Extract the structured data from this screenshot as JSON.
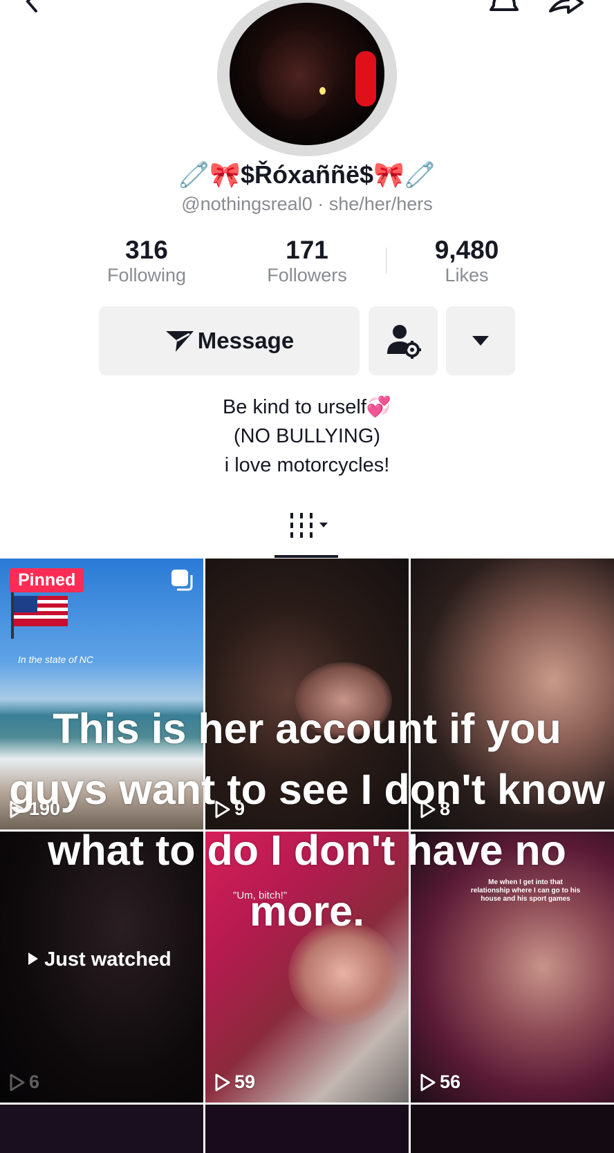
{
  "profile": {
    "display_name": "🧷🎀$Řóxaññë$🎀🧷",
    "handle_line": "@nothingsreal0 · she/her/hers",
    "stats": [
      {
        "value": "316",
        "label": "Following"
      },
      {
        "value": "171",
        "label": "Followers"
      },
      {
        "value": "9,480",
        "label": "Likes"
      }
    ],
    "bio": [
      "Be kind to urself💞",
      "(NO BULLYING)",
      "i love motorcycles!"
    ]
  },
  "actions": {
    "message_label": "Message"
  },
  "videos": [
    {
      "views": "190",
      "badge": "Pinned",
      "caption": "In the state of NC"
    },
    {
      "views": "9"
    },
    {
      "views": "8"
    },
    {
      "views": "6",
      "status": "Just watched"
    },
    {
      "views": "59",
      "caption": "\"Um, bitch!\""
    },
    {
      "views": "56",
      "caption": "Me when I get into that relationship where I can go to his house and his sport games"
    }
  ],
  "overlay_caption": "This is her account if you guys want to see  I don't know what to do I don't have no more.",
  "icons": [
    "back-icon",
    "bell-icon",
    "share-icon",
    "send-icon",
    "friend-settings-icon",
    "dropdown-icon",
    "grid-icon",
    "play-icon",
    "multi-post-icon"
  ],
  "colors": {
    "pinned_badge": "#fe2c55",
    "text_primary": "#161823",
    "text_secondary": "#8a8b91",
    "button_bg": "#f1f1f2"
  }
}
